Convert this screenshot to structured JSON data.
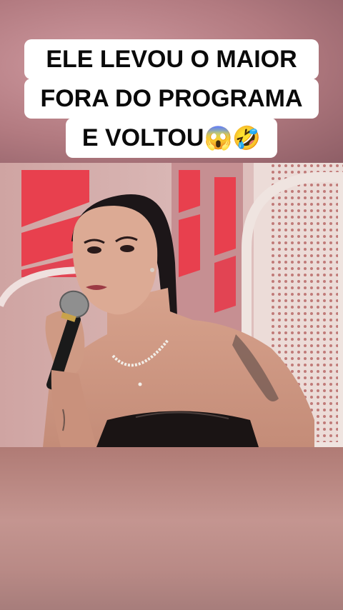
{
  "caption": {
    "line1": "ELE LEVOU O MAIOR",
    "line2": "FORA DO PROGRAMA",
    "line3": "E VOLTOU",
    "emojis": "😱🤣"
  },
  "colors": {
    "caption_bg": "#ffffff",
    "caption_text": "#0a0a0a",
    "stage_red": "#e8404e",
    "dress": "#1a1414"
  },
  "video": {
    "subject": "woman-singing-into-microphone",
    "icon_names": [
      "microphone-icon"
    ]
  }
}
